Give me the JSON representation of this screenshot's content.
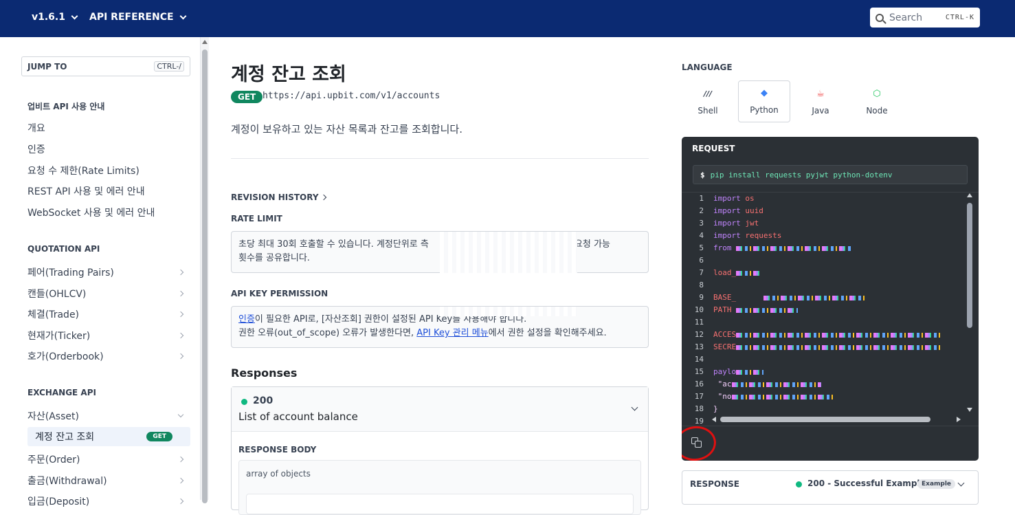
{
  "topbar": {
    "version": "v1.6.1",
    "api_reference": "API REFERENCE",
    "search_placeholder": "Search",
    "search_shortcut": "CTRL-K"
  },
  "sidebar": {
    "jump_to": "JUMP TO",
    "jump_shortcut": "CTRL-/",
    "groups": [
      {
        "title": "업비트 API 사용 안내",
        "items": [
          "개요",
          "인증",
          "요청 수 제한(Rate Limits)",
          "REST API 사용 및 에러 안내",
          "WebSocket 사용 및 에러 안내"
        ]
      },
      {
        "title": "QUOTATION API",
        "items": [
          "페어(Trading Pairs)",
          "캔들(OHLCV)",
          "체결(Trade)",
          "현재가(Ticker)",
          "호가(Orderbook)"
        ]
      },
      {
        "title": "EXCHANGE API",
        "items": [
          "자산(Asset)",
          "계정 잔고 조회",
          "주문(Order)",
          "출금(Withdrawal)",
          "입금(Deposit)"
        ]
      }
    ],
    "active_badge": "GET"
  },
  "main": {
    "title": "계정 잔고 조회",
    "method": "GET",
    "endpoint": "https://api.upbit.com/v1/accounts",
    "description": "계정이 보유하고 있는 자산 목록과 잔고를 조회합니다.",
    "revision_history": "REVISION HISTORY",
    "rate_limit_label": "RATE LIMIT",
    "rate_limit_text_1": "초당 최대 30회 호출할 수 있습니다. 계정단위로 측",
    "rate_limit_text_1b": "서 요청 가능",
    "rate_limit_text_2": "횟수를 공유합니다.",
    "permission_label": "API KEY PERMISSION",
    "permission_link": "인증",
    "permission_text_1": "이 필요한 API로, [자산조회] 권한이 설정된 API Key를 사용해야 합니다.",
    "permission_text_2a": "권한 오류(out_of_scope) 오류가 발생한다면, ",
    "permission_link_2": "API Key 관리 메뉴",
    "permission_text_2b": "에서 권한 설정을 확인해주세요.",
    "responses_heading": "Responses",
    "response_code": "200",
    "response_desc": "List of account balance",
    "response_body_label": "RESPONSE BODY",
    "response_body_type": "array of objects"
  },
  "right": {
    "language_label": "LANGUAGE",
    "languages": [
      {
        "name": "Shell",
        "icon": "terminal-icon",
        "glyph": "///",
        "color": "#374151"
      },
      {
        "name": "Python",
        "icon": "python-icon",
        "glyph": "◆",
        "color": "#3b82f6"
      },
      {
        "name": "Java",
        "icon": "java-icon",
        "glyph": "☕",
        "color": "#ef4444"
      },
      {
        "name": "Node",
        "icon": "node-icon",
        "glyph": "⬡",
        "color": "#22c55e"
      }
    ],
    "request_label": "REQUEST",
    "install_prompt": "$",
    "install_cmd": "pip install requests pyjwt python-dotenv",
    "code_lines": [
      {
        "n": "1",
        "kw": "import",
        "rest": " os"
      },
      {
        "n": "2",
        "kw": "import",
        "rest": " uuid"
      },
      {
        "n": "3",
        "kw": "import",
        "rest": " jwt"
      },
      {
        "n": "4",
        "kw": "import",
        "rest": " requests"
      },
      {
        "n": "5",
        "kw": "from",
        "rest": " "
      },
      {
        "n": "6",
        "kw": "",
        "rest": ""
      },
      {
        "n": "7",
        "kw": "",
        "rest": "load_"
      },
      {
        "n": "8",
        "kw": "",
        "rest": ""
      },
      {
        "n": "9",
        "kw": "",
        "rest": "BASE_"
      },
      {
        "n": "10",
        "kw": "",
        "rest": "PATH "
      },
      {
        "n": "11",
        "kw": "",
        "rest": ""
      },
      {
        "n": "12",
        "kw": "",
        "rest": "ACCES"
      },
      {
        "n": "13",
        "kw": "",
        "rest": "SECRE"
      },
      {
        "n": "14",
        "kw": "",
        "rest": ""
      },
      {
        "n": "15",
        "kw": "",
        "rest": "paylo"
      },
      {
        "n": "16",
        "kw": "",
        "rest": "  \"ac"
      },
      {
        "n": "17",
        "kw": "",
        "rest": "  \"no"
      },
      {
        "n": "18",
        "kw": "",
        "rest": "}"
      },
      {
        "n": "19",
        "kw": "",
        "rest": ""
      }
    ],
    "response_label": "RESPONSE",
    "response_status": "200 - Successful Example",
    "example_badge": "Example"
  }
}
